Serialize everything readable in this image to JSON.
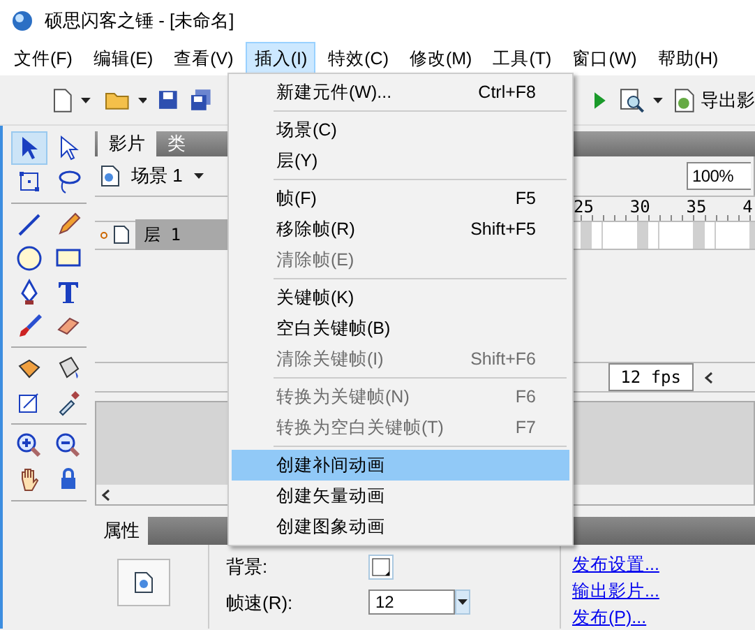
{
  "window": {
    "title": "硕思闪客之锤 - [未命名]"
  },
  "menubar": [
    {
      "label": "文件(F)",
      "selected": false
    },
    {
      "label": "编辑(E)",
      "selected": false
    },
    {
      "label": "查看(V)",
      "selected": false
    },
    {
      "label": "插入(I)",
      "selected": true
    },
    {
      "label": "特效(C)",
      "selected": false
    },
    {
      "label": "修改(M)",
      "selected": false
    },
    {
      "label": "工具(T)",
      "selected": false
    },
    {
      "label": "窗口(W)",
      "selected": false
    },
    {
      "label": "帮助(H)",
      "selected": false
    }
  ],
  "toolbar": {
    "export_label": "导出影"
  },
  "tools": [
    {
      "selected": true
    },
    {
      "selected": false
    },
    {
      "selected": false
    },
    {
      "selected": false
    },
    {
      "selected": false
    },
    {
      "selected": false
    },
    {
      "selected": false
    },
    {
      "selected": false
    },
    {
      "selected": false
    },
    {
      "selected": false
    },
    {
      "selected": false
    },
    {
      "selected": false
    },
    {
      "selected": false
    },
    {
      "selected": false
    },
    {
      "selected": false
    },
    {
      "selected": false
    },
    {
      "selected": false
    },
    {
      "selected": false
    },
    {
      "selected": false
    },
    {
      "selected": false
    }
  ],
  "timeline": {
    "tabs": [
      {
        "label": "影片",
        "selected": true
      },
      {
        "label": "类",
        "selected": false
      }
    ],
    "scene": "场景 1",
    "zoom": "100%",
    "ruler": [
      "25",
      "30",
      "35",
      "4"
    ],
    "layer": {
      "name": "层 1",
      "selected": true
    },
    "fps": "12 fps"
  },
  "properties": {
    "tab": "属性",
    "background_label": "背景:",
    "frame_rate_label": "帧速(R):",
    "frame_rate": "12",
    "links": [
      "发布设置...",
      "输出影片...",
      "发布(P)..."
    ]
  },
  "menu": [
    {
      "kind": "item",
      "label": "新建元件(W)...",
      "shortcut": "Ctrl+F8",
      "disabled": false,
      "selected": false
    },
    {
      "kind": "separator"
    },
    {
      "kind": "item",
      "label": "场景(C)",
      "disabled": false,
      "selected": false
    },
    {
      "kind": "item",
      "label": "层(Y)",
      "disabled": false,
      "selected": false
    },
    {
      "kind": "separator"
    },
    {
      "kind": "item",
      "label": "帧(F)",
      "shortcut": "F5",
      "disabled": false,
      "selected": false
    },
    {
      "kind": "item",
      "label": "移除帧(R)",
      "shortcut": "Shift+F5",
      "disabled": false,
      "selected": false
    },
    {
      "kind": "item",
      "label": "清除帧(E)",
      "disabled": true,
      "selected": false
    },
    {
      "kind": "separator"
    },
    {
      "kind": "item",
      "label": "关键帧(K)",
      "disabled": false,
      "selected": false
    },
    {
      "kind": "item",
      "label": "空白关键帧(B)",
      "disabled": false,
      "selected": false
    },
    {
      "kind": "item",
      "label": "清除关键帧(I)",
      "shortcut": "Shift+F6",
      "disabled": true,
      "selected": false
    },
    {
      "kind": "separator"
    },
    {
      "kind": "item",
      "label": "转换为关键帧(N)",
      "shortcut": "F6",
      "disabled": true,
      "selected": false
    },
    {
      "kind": "item",
      "label": "转换为空白关键帧(T)",
      "shortcut": "F7",
      "disabled": true,
      "selected": false
    },
    {
      "kind": "separator"
    },
    {
      "kind": "item",
      "label": "创建补间动画",
      "disabled": false,
      "selected": true
    },
    {
      "kind": "item",
      "label": "创建矢量动画",
      "disabled": false,
      "selected": false
    },
    {
      "kind": "item",
      "label": "创建图象动画",
      "disabled": false,
      "selected": false
    }
  ]
}
